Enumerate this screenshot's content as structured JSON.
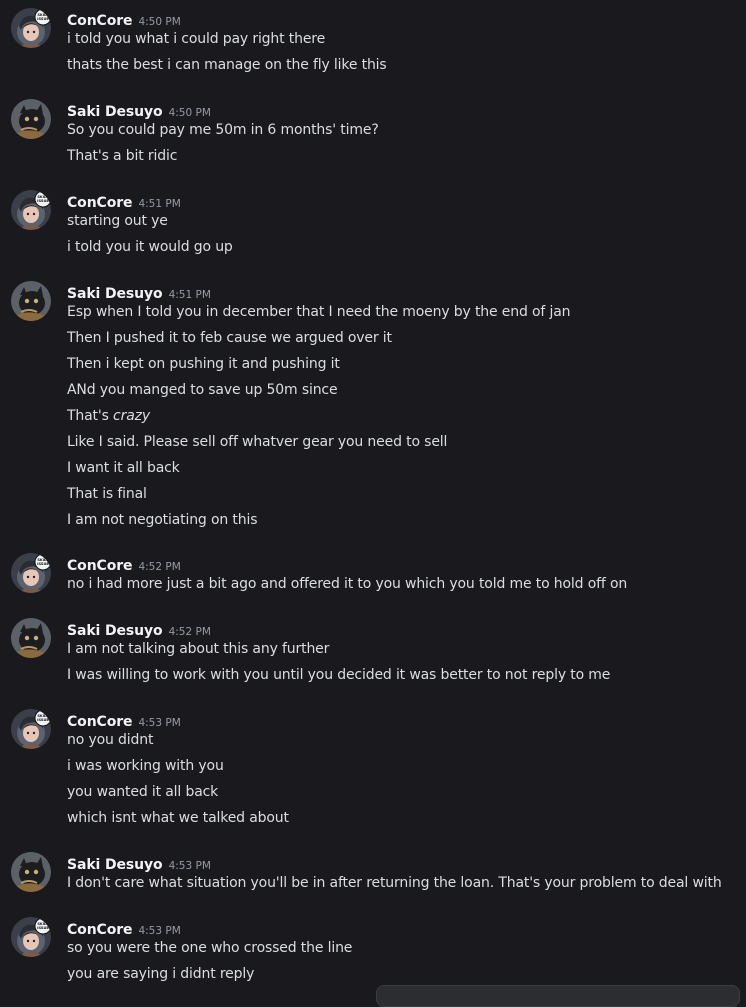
{
  "groups": [
    {
      "author": "ConCore",
      "avatar": "concore",
      "time": "4:50 PM",
      "messages": [
        "i told you what i could pay right there",
        "thats the best i can manage on the fly like this"
      ]
    },
    {
      "author": "Saki Desuyo",
      "avatar": "saki",
      "time": "4:50 PM",
      "messages": [
        "So you could pay me 50m in 6 months' time?",
        "That's a bit ridic"
      ]
    },
    {
      "author": "ConCore",
      "avatar": "concore",
      "time": "4:51 PM",
      "messages": [
        "starting out ye",
        "i told you it would go up"
      ]
    },
    {
      "author": "Saki Desuyo",
      "avatar": "saki",
      "time": "4:51 PM",
      "messages": [
        "Esp when I told you in december that I need the moeny by the end of jan",
        "Then I pushed it to feb cause we argued over it",
        "Then i kept on pushing it and pushing it",
        "ANd you manged to save up 50m since",
        {
          "prefix": "That's ",
          "italic": "crazy"
        },
        "Like I said. Please sell off whatver gear you need to sell",
        "I want it all back",
        "That is final",
        "I am not negotiating on this"
      ]
    },
    {
      "author": "ConCore",
      "avatar": "concore",
      "time": "4:52 PM",
      "messages": [
        "no i had more just a bit ago and offered it to you which you told me to hold off on"
      ]
    },
    {
      "author": "Saki Desuyo",
      "avatar": "saki",
      "time": "4:52 PM",
      "messages": [
        "I am not talking about this any further",
        "I was willing to work with you until you decided it was better to not reply to me"
      ]
    },
    {
      "author": "ConCore",
      "avatar": "concore",
      "time": "4:53 PM",
      "messages": [
        "no you didnt",
        "i was working with you",
        "you wanted it all back",
        "which isnt what we talked about"
      ]
    },
    {
      "author": "Saki Desuyo",
      "avatar": "saki",
      "time": "4:53 PM",
      "messages": [
        "I don't care what situation you'll be in after returning the loan. That's your problem to deal with"
      ]
    },
    {
      "author": "ConCore",
      "avatar": "concore",
      "time": "4:53 PM",
      "messages": [
        "so you were the one who crossed the line",
        "you are saying i didnt reply"
      ]
    }
  ]
}
